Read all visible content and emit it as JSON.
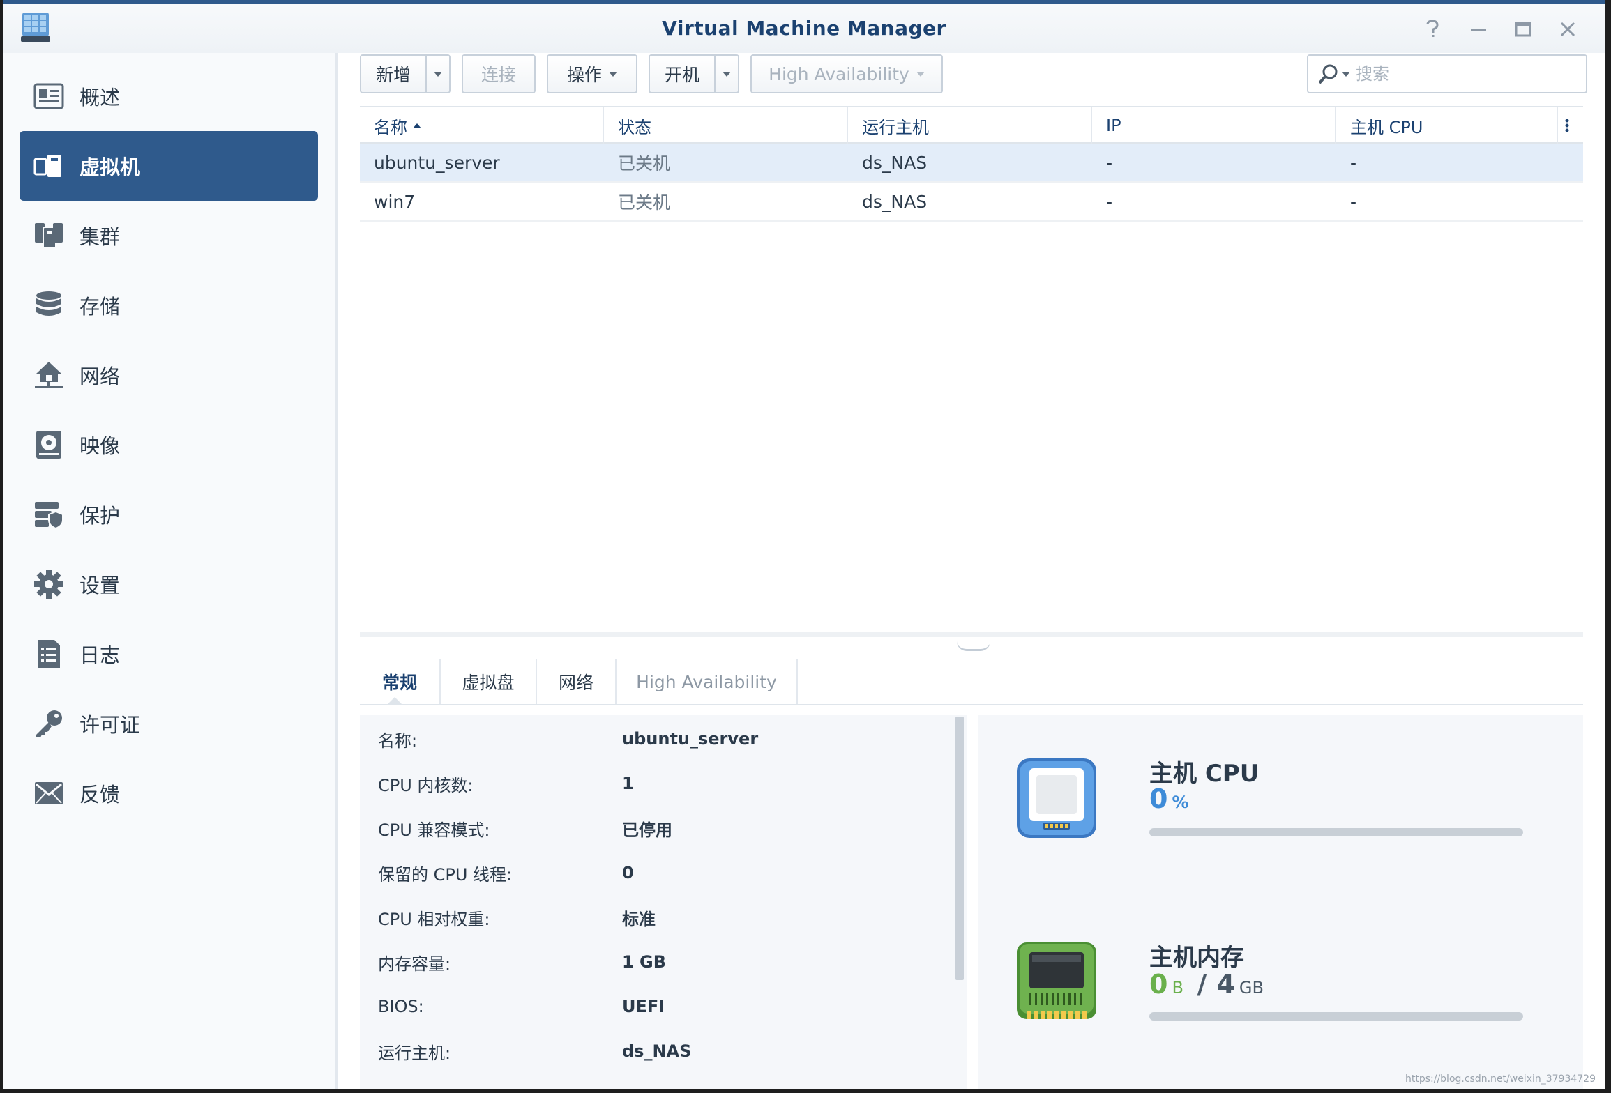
{
  "window": {
    "title": "Virtual Machine Manager",
    "controls": [
      "help-icon",
      "minimize-icon",
      "maximize-icon",
      "close-icon"
    ]
  },
  "sidebar": {
    "items": [
      {
        "label": "概述",
        "icon": "overview-icon",
        "active": false
      },
      {
        "label": "虚拟机",
        "icon": "virtual-machine-icon",
        "active": true
      },
      {
        "label": "集群",
        "icon": "cluster-icon",
        "active": false
      },
      {
        "label": "存储",
        "icon": "storage-icon",
        "active": false
      },
      {
        "label": "网络",
        "icon": "network-icon",
        "active": false
      },
      {
        "label": "映像",
        "icon": "image-icon",
        "active": false
      },
      {
        "label": "保护",
        "icon": "protection-icon",
        "active": false
      },
      {
        "label": "设置",
        "icon": "settings-icon",
        "active": false
      },
      {
        "label": "日志",
        "icon": "log-icon",
        "active": false
      },
      {
        "label": "许可证",
        "icon": "license-icon",
        "active": false
      },
      {
        "label": "反馈",
        "icon": "feedback-icon",
        "active": false
      }
    ]
  },
  "toolbar": {
    "create_label": "新增",
    "connect_label": "连接",
    "action_label": "操作",
    "power_on_label": "开机",
    "ha_label": "High Availability",
    "search_placeholder": "搜索"
  },
  "grid": {
    "columns": [
      "名称",
      "状态",
      "运行主机",
      "IP",
      "主机 CPU"
    ],
    "rows": [
      {
        "name": "ubuntu_server",
        "status": "已关机",
        "host": "ds_NAS",
        "ip": "-",
        "cpu": "-",
        "selected": true
      },
      {
        "name": "win7",
        "status": "已关机",
        "host": "ds_NAS",
        "ip": "-",
        "cpu": "-",
        "selected": false
      }
    ]
  },
  "detail_tabs": [
    {
      "label": "常规",
      "active": true,
      "disabled": false
    },
    {
      "label": "虚拟盘",
      "active": false,
      "disabled": false
    },
    {
      "label": "网络",
      "active": false,
      "disabled": false
    },
    {
      "label": "High Availability",
      "active": false,
      "disabled": true
    }
  ],
  "properties": [
    {
      "key": "名称:",
      "value": "ubuntu_server"
    },
    {
      "key": "CPU 内核数:",
      "value": "1"
    },
    {
      "key": "CPU 兼容模式:",
      "value": "已停用"
    },
    {
      "key": "保留的 CPU 线程:",
      "value": "0"
    },
    {
      "key": "CPU 相对权重:",
      "value": "标准"
    },
    {
      "key": "内存容量:",
      "value": "1 GB"
    },
    {
      "key": "BIOS:",
      "value": "UEFI"
    },
    {
      "key": "运行主机:",
      "value": "ds_NAS"
    }
  ],
  "stats": {
    "cpu": {
      "title": "主机 CPU",
      "value": "0",
      "unit": "%",
      "fraction": 0,
      "icon": "cpu-chip-icon",
      "value_color": "#3d8bd8"
    },
    "memory": {
      "title": "主机内存",
      "used": "0",
      "used_unit": "B",
      "separator": "/",
      "total": "4",
      "total_unit": "GB",
      "fraction": 0,
      "icon": "memory-module-icon",
      "value_color": "#6ab04c"
    }
  },
  "watermark": "https://blog.csdn.net/weixin_37934729",
  "colors": {
    "accent": "#2f5a8c",
    "title": "#1b4170",
    "selection": "#e3edf9"
  }
}
